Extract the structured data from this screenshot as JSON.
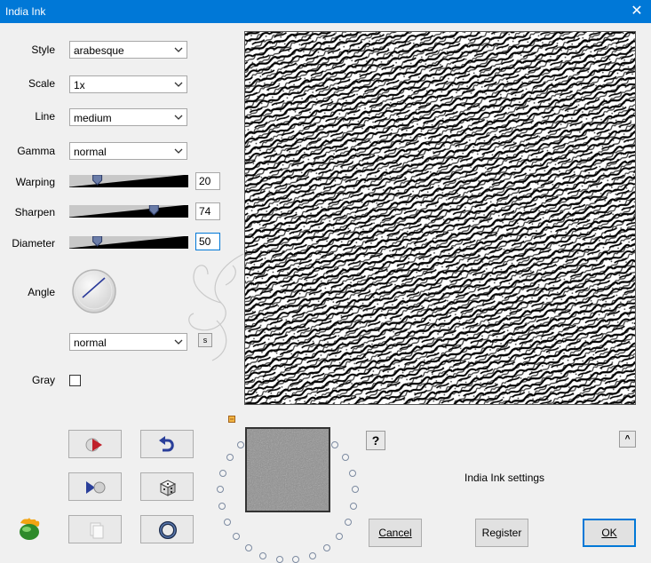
{
  "window": {
    "title": "India Ink",
    "close_glyph": "✕"
  },
  "controls": {
    "style": {
      "label": "Style",
      "value": "arabesque"
    },
    "scale": {
      "label": "Scale",
      "value": "1x"
    },
    "line": {
      "label": "Line",
      "value": "medium"
    },
    "gamma": {
      "label": "Gamma",
      "value": "normal"
    },
    "warping": {
      "label": "Warping",
      "value": "20",
      "level": 0.2
    },
    "sharpen": {
      "label": "Sharpen",
      "value": "74",
      "level": 0.74
    },
    "diameter": {
      "label": "Diameter",
      "value": "50",
      "level": 0.2
    },
    "angle": {
      "label": "Angle"
    },
    "mode": {
      "value": "normal"
    },
    "s_button": "s",
    "gray": {
      "label": "Gray",
      "checked": false
    }
  },
  "tools": {
    "icons": [
      "play-icon",
      "undo-icon",
      "next-frame-icon",
      "dice-icon",
      "copy-icon",
      "ring-icon"
    ]
  },
  "help_glyph": "?",
  "caret_glyph": "^",
  "status_text": "India Ink settings",
  "buttons": {
    "cancel": "Cancel",
    "register": "Register",
    "ok": "OK"
  },
  "colors": {
    "titlebar": "#0078d7",
    "accent": "#0078d7"
  }
}
